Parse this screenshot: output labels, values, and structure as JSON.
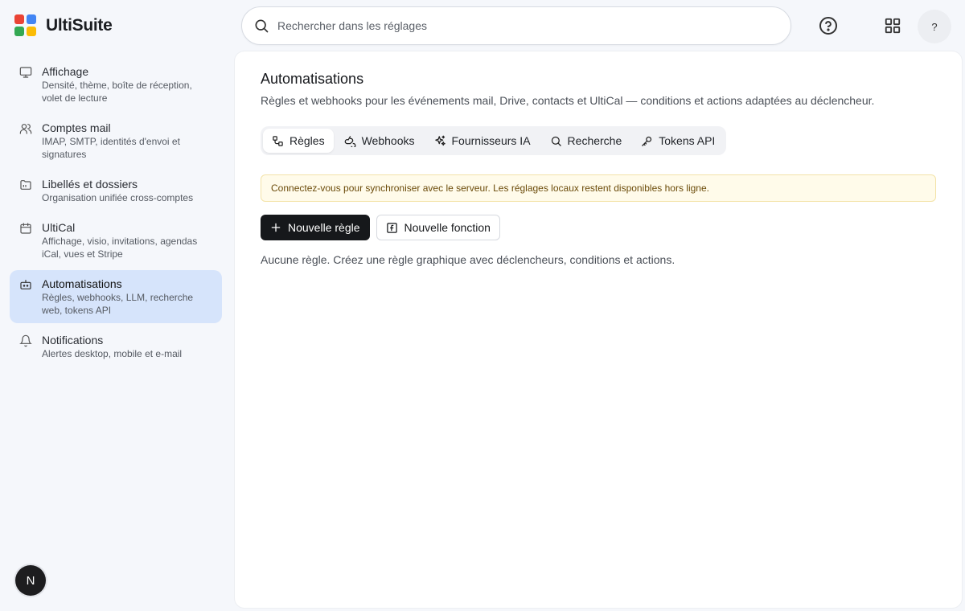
{
  "app": {
    "title": "UltiSuite",
    "colors": {
      "red": "#ea4335",
      "blue": "#4285f4",
      "green": "#34a853",
      "yellow": "#fbbc05"
    }
  },
  "search": {
    "placeholder": "Rechercher dans les réglages",
    "value": ""
  },
  "header": {
    "help_icon": "help-circle-icon",
    "apps_icon": "apps-grid-icon",
    "account_label": "?"
  },
  "sidebar": {
    "items": [
      {
        "title": "Affichage",
        "desc": "Densité, thème, boîte de réception, volet de lecture",
        "icon": "monitor-icon"
      },
      {
        "title": "Comptes mail",
        "desc": "IMAP, SMTP, identités d'envoi et signatures",
        "icon": "users-icon"
      },
      {
        "title": "Libellés et dossiers",
        "desc": "Organisation unifiée cross-comptes",
        "icon": "folder-icon"
      },
      {
        "title": "UltiCal",
        "desc": "Affichage, visio, invitations, agendas iCal, vues et Stripe",
        "icon": "calendar-icon"
      },
      {
        "title": "Automatisations",
        "desc": "Règles, webhooks, LLM, recherche web, tokens API",
        "icon": "bot-icon",
        "active": true
      },
      {
        "title": "Notifications",
        "desc": "Alertes desktop, mobile et e-mail",
        "icon": "bell-icon"
      }
    ],
    "user_initial": "N"
  },
  "main": {
    "title": "Automatisations",
    "subtitle": "Règles et webhooks pour les événements mail, Drive, contacts et UltiCal — conditions et actions adaptées au déclencheur.",
    "tabs": [
      {
        "label": "Règles",
        "icon": "workflow-icon",
        "active": true
      },
      {
        "label": "Webhooks",
        "icon": "webhook-icon"
      },
      {
        "label": "Fournisseurs IA",
        "icon": "sparkles-icon"
      },
      {
        "label": "Recherche",
        "icon": "search-icon"
      },
      {
        "label": "Tokens API",
        "icon": "key-icon"
      }
    ],
    "banner": "Connectez-vous pour synchroniser avec le serveur. Les réglages locaux restent disponibles hors ligne.",
    "new_rule_label": "Nouvelle règle",
    "new_function_label": "Nouvelle fonction",
    "empty_text": "Aucune règle. Créez une règle graphique avec déclencheurs, conditions et actions."
  }
}
